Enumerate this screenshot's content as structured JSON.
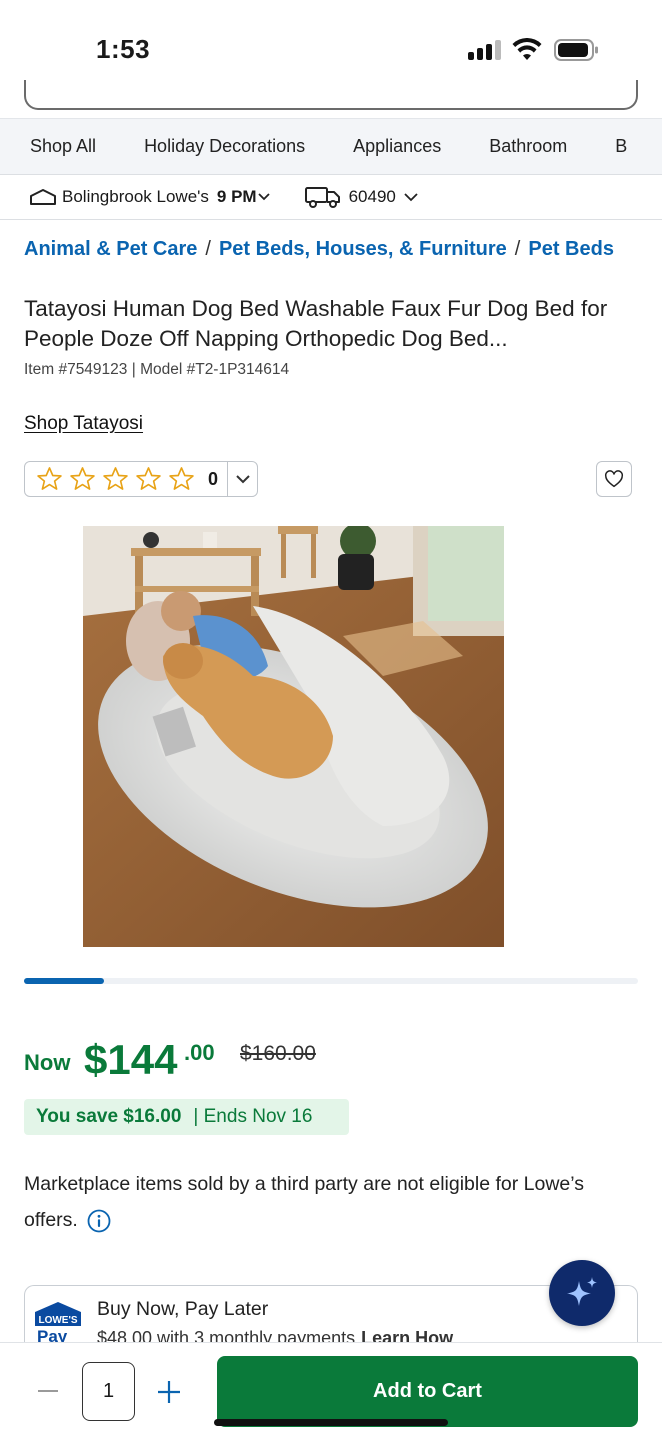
{
  "status_bar": {
    "time": "1:53"
  },
  "nav": {
    "items": [
      "Shop All",
      "Holiday Decorations",
      "Appliances",
      "Bathroom",
      "B"
    ]
  },
  "store": {
    "name": "Bolingbrook Lowe's",
    "hours": "9 PM",
    "zip": "60490"
  },
  "breadcrumb": {
    "items": [
      "Animal & Pet Care",
      "Pet Beds, Houses, & Furniture",
      "Pet Beds"
    ],
    "separator": "/"
  },
  "product": {
    "title": "Tatayosi Human Dog Bed Washable Faux Fur Dog Bed for People Doze Off Napping Orthopedic Dog Bed...",
    "item_number": "Item #7549123",
    "model_number": "Model #T2-1P314614",
    "meta_separator": "|",
    "shop_brand": "Shop Tatayosi",
    "rating": {
      "stars": 0,
      "count": "0"
    },
    "image_position": 0.13
  },
  "price": {
    "now_label": "Now",
    "dollars": "$144",
    "cents": ".00",
    "was": "$160.00",
    "savings": "You save $16.00",
    "ends": "| Ends Nov 16"
  },
  "notice": {
    "text": "Marketplace items sold by a third party are not eligible for Lowe’s offers."
  },
  "pay_later": {
    "logo_top": "LOWE'S",
    "logo_bottom": "Pay",
    "title": "Buy Now, Pay Later",
    "subtitle": "$48.00 with 3 monthly payments",
    "learn": "Learn How"
  },
  "cart": {
    "quantity": "1",
    "add_label": "Add to Cart"
  },
  "colors": {
    "brand_blue": "#0a64b0",
    "price_green": "#0a7a3a",
    "savings_bg": "#e3f5e8",
    "cta_green": "#0a7a3a",
    "fab_navy": "#0f2a6b"
  }
}
